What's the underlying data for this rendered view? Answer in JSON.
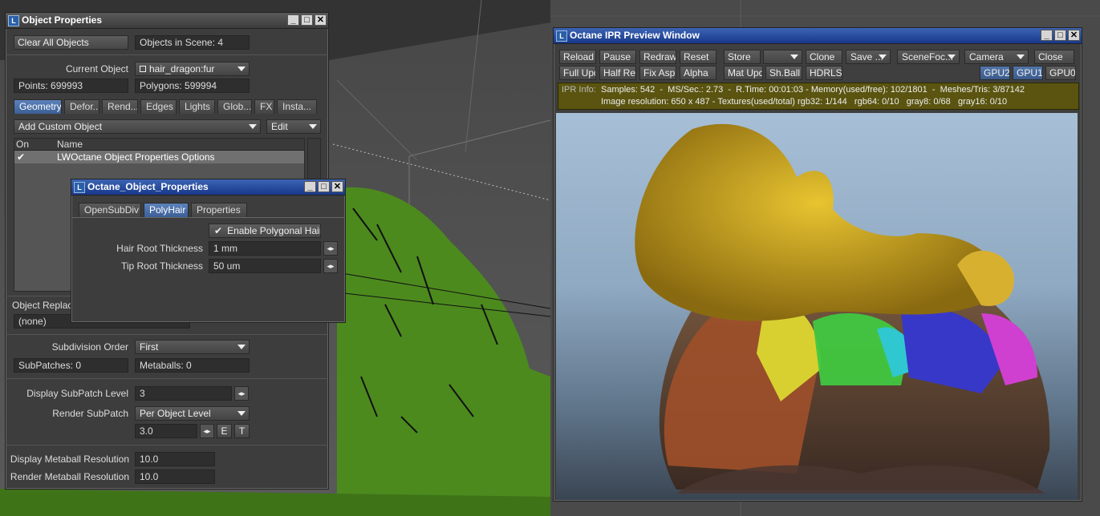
{
  "object_properties": {
    "title": "Object Properties",
    "clear_all": "Clear All Objects",
    "objects_in_scene": "Objects in Scene: 4",
    "current_object_label": "Current Object",
    "current_object": "hair_dragon:fur",
    "points": "Points: 699993",
    "polygons": "Polygons: 599994",
    "tabs": [
      "Geometry",
      "Defor...",
      "Rend...",
      "Edges",
      "Lights",
      "Glob...",
      "FX",
      "Insta..."
    ],
    "add_custom": "Add Custom Object",
    "edit": "Edit",
    "col_on": "On",
    "col_name": "Name",
    "row_check": "✔",
    "row_name": "LWOctane Object Properties Options",
    "object_replace_label": "Object Replace",
    "object_replace_value": "(none)",
    "subdiv_order_label": "Subdivision Order",
    "subdiv_order": "First",
    "subpatches": "SubPatches: 0",
    "metaballs": "Metaballs: 0",
    "display_subpatch_label": "Display SubPatch Level",
    "display_subpatch": "3",
    "render_subpatch_label": "Render SubPatch",
    "render_subpatch": "Per Object Level",
    "render_subpatch_value": "3.0",
    "e": "E",
    "t": "T",
    "display_meta_label": "Display Metaball Resolution",
    "display_meta": "10.0",
    "render_meta_label": "Render Metaball Resolution",
    "render_meta": "10.0"
  },
  "octane_obj": {
    "title": "Octane_Object_Properties",
    "tabs": [
      "OpenSubDiv",
      "PolyHair",
      "Properties"
    ],
    "enable_label": "Enable Polygonal Hair",
    "check": "✔",
    "hair_root_label": "Hair Root Thickness",
    "hair_root": "1 mm",
    "tip_root_label": "Tip Root Thickness",
    "tip_root": "50 um"
  },
  "ipr": {
    "title": "Octane IPR Preview Window",
    "row1": [
      "Reload",
      "Pause",
      "Redraw",
      "Reset",
      "Store",
      "",
      "Clone",
      "Save ...",
      "SceneFoc...",
      "Camera",
      "Close"
    ],
    "row2": [
      "Full Upd.",
      "Half Res",
      "Fix Asp.",
      "Alpha",
      "Mat Upd",
      "Sh.Ball",
      "HDRLS"
    ],
    "gpus": [
      "GPU2",
      "GPU1",
      "GPU0"
    ],
    "info_label": "IPR Info:",
    "info_line1": "Samples: 542  -  MS/Sec.: 2.73  -  R.Time: 00:01:03 - Memory(used/free): 102/1801  -  Meshes/Tris: 3/87142",
    "info_line2": "Image resolution: 650 x 487 - Textures(used/total) rgb32: 1/144   rgb64: 0/10   gray8: 0/68   gray16: 0/10"
  },
  "win_buttons": {
    "min": "_",
    "max": "□",
    "close": "✕"
  },
  "colors": {
    "accent": "#3b5a8c",
    "info_bg": "#5a5410",
    "viewport_green": "#4c8a1e"
  }
}
